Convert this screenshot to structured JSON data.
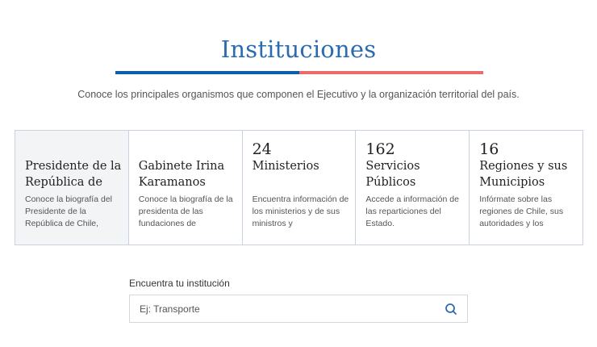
{
  "header": {
    "title": "Instituciones",
    "subtitle": "Conoce los principales organismos que componen el Ejecutivo y la organización territorial del país."
  },
  "cards": [
    {
      "number": "",
      "title": "Presidente de la República de",
      "description": "Conoce la biografía del Presidente de la República de Chile,"
    },
    {
      "number": "",
      "title": "Gabinete Irina Karamanos",
      "description": "Conoce la biografía de la presidenta de las fundaciones de"
    },
    {
      "number": "24",
      "title": "Ministerios",
      "description": "Encuentra información de los ministerios y de sus ministros y"
    },
    {
      "number": "162",
      "title": "Servicios Públicos",
      "description": "Accede a información de las reparticiones del Estado."
    },
    {
      "number": "16",
      "title": "Regiones y sus Municipios",
      "description": "Infórmate sobre las regiones de Chile, sus autoridades y los"
    }
  ],
  "search": {
    "label": "Encuentra tu institución",
    "placeholder": "Ej: Transporte",
    "value": "",
    "icon": "search-icon"
  },
  "colors": {
    "title": "#2b6cb0",
    "underline_blue": "#0b5ea8",
    "underline_red": "#ec6a6a",
    "card_border": "#c9d3df",
    "active_card_bg": "#f3f4f6"
  }
}
